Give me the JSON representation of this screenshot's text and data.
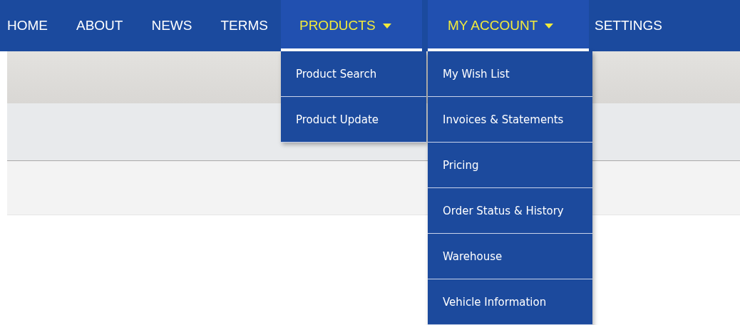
{
  "nav": {
    "items": [
      {
        "label": "HOME",
        "kind": "link"
      },
      {
        "label": "ABOUT",
        "kind": "link"
      },
      {
        "label": "NEWS",
        "kind": "link"
      },
      {
        "label": "TERMS",
        "kind": "link"
      },
      {
        "label": "PRODUCTS",
        "kind": "dropdown",
        "expanded": true,
        "menu": [
          "Product Search",
          "Product Update"
        ]
      },
      {
        "label": "MY ACCOUNT",
        "kind": "dropdown",
        "expanded": true,
        "menu": [
          "My Wish List",
          "Invoices & Statements",
          "Pricing",
          "Order Status & History",
          "Warehouse",
          "Vehicle Information"
        ]
      },
      {
        "label": "SETTINGS",
        "kind": "link"
      }
    ]
  }
}
